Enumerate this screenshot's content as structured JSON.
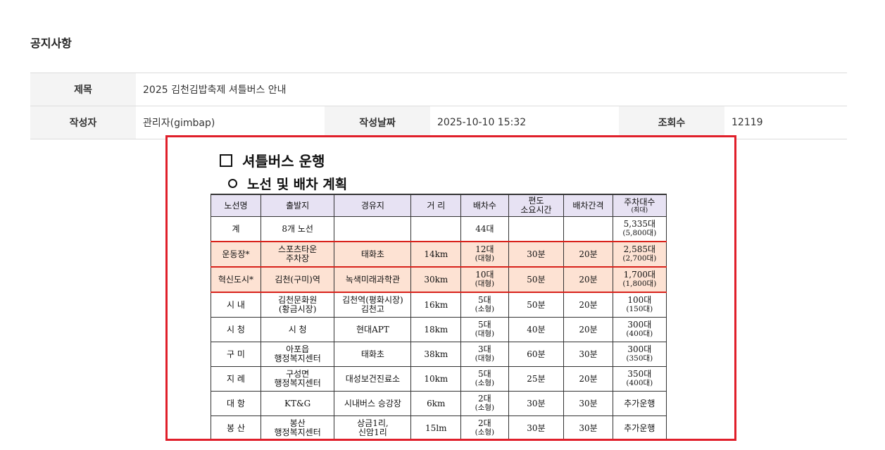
{
  "page": {
    "heading": "공지사항"
  },
  "meta": {
    "title_label": "제목",
    "title_value": "2025 김천김밥축제 셔틀버스 안내",
    "author_label": "작성자",
    "author_value": "관리자(gimbap)",
    "date_label": "작성날짜",
    "date_value": "2025-10-10 15:32",
    "views_label": "조회수",
    "views_value": "12119"
  },
  "notice_image": {
    "title": "셔틀버스 운행",
    "subtitle": "노선 및 배차 계획",
    "highlight_color": "#e01f2a",
    "table": {
      "headers": [
        {
          "main": "노선명",
          "sub": ""
        },
        {
          "main": "출발지",
          "sub": ""
        },
        {
          "main": "경유지",
          "sub": ""
        },
        {
          "main": "거 리",
          "sub": ""
        },
        {
          "main": "배차수",
          "sub": ""
        },
        {
          "main": "편도",
          "sub": "소요시간"
        },
        {
          "main": "배차간격",
          "sub": ""
        },
        {
          "main": "주차대수",
          "sub": "(최대)"
        }
      ],
      "rows": [
        {
          "route": "계",
          "origin": "8개 노선",
          "via": "",
          "distance": "",
          "buses": "44대",
          "buses_sub": "",
          "time": "",
          "interval": "",
          "parking": "5,335대",
          "parking_sub": "(5,800대)",
          "highlight": false
        },
        {
          "route": "운동장*",
          "origin": "스포츠타운",
          "origin_sub": "주차장",
          "via": "태화초",
          "distance": "14km",
          "buses": "12대",
          "buses_sub": "(대형)",
          "time": "30분",
          "interval": "20분",
          "parking": "2,585대",
          "parking_sub": "(2,700대)",
          "highlight": true
        },
        {
          "route": "혁신도시*",
          "origin": "김천(구미)역",
          "via": "녹색미래과학관",
          "distance": "30km",
          "buses": "10대",
          "buses_sub": "(대형)",
          "time": "50분",
          "interval": "20분",
          "parking": "1,700대",
          "parking_sub": "(1,800대)",
          "highlight": true
        },
        {
          "route": "시 내",
          "origin": "김천문화원",
          "origin_sub": "(황금시장)",
          "via": "김천역(평화시장)",
          "via_sub": "김천고",
          "distance": "16km",
          "buses": "5대",
          "buses_sub": "(소형)",
          "time": "50분",
          "interval": "20분",
          "parking": "100대",
          "parking_sub": "(150대)",
          "highlight": false
        },
        {
          "route": "시 청",
          "origin": "시 청",
          "via": "현대APT",
          "distance": "18km",
          "buses": "5대",
          "buses_sub": "(대형)",
          "time": "40분",
          "interval": "20분",
          "parking": "300대",
          "parking_sub": "(400대)",
          "highlight": false
        },
        {
          "route": "구 미",
          "origin": "아포읍",
          "origin_sub": "행정복지센터",
          "via": "태화초",
          "distance": "38km",
          "buses": "3대",
          "buses_sub": "(대형)",
          "time": "60분",
          "interval": "30분",
          "parking": "300대",
          "parking_sub": "(350대)",
          "highlight": false
        },
        {
          "route": "지 례",
          "origin": "구성면",
          "origin_sub": "행정복지센터",
          "via": "대성보건진료소",
          "distance": "10km",
          "buses": "5대",
          "buses_sub": "(소형)",
          "time": "25분",
          "interval": "20분",
          "parking": "350대",
          "parking_sub": "(400대)",
          "highlight": false
        },
        {
          "route": "대 항",
          "origin": "KT&G",
          "via": "시내버스 승강장",
          "distance": "6km",
          "buses": "2대",
          "buses_sub": "(소형)",
          "time": "30분",
          "interval": "30분",
          "parking": "추가운행",
          "parking_sub": "",
          "highlight": false
        },
        {
          "route": "봉 산",
          "origin": "봉산",
          "origin_sub": "행정복지센터",
          "via": "상금1리,",
          "via_sub": "신암1리",
          "distance": "15lm",
          "buses": "2대",
          "buses_sub": "(소형)",
          "time": "30분",
          "interval": "30분",
          "parking": "추가운행",
          "parking_sub": "",
          "highlight": false
        }
      ]
    }
  }
}
